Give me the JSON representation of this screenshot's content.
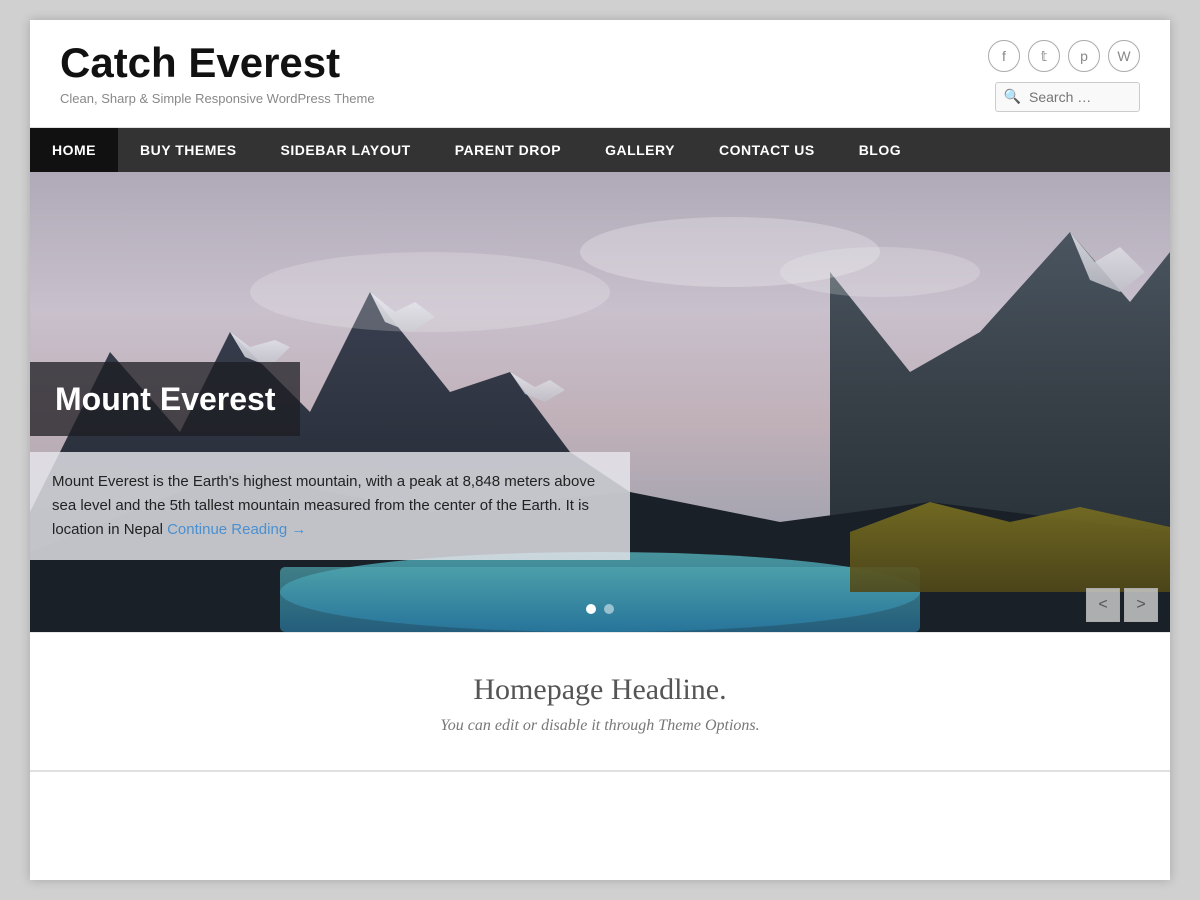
{
  "site": {
    "title": "Catch Everest",
    "description": "Clean, Sharp & Simple Responsive WordPress Theme"
  },
  "social": {
    "icons": [
      {
        "name": "facebook-icon",
        "symbol": "f"
      },
      {
        "name": "twitter-icon",
        "symbol": "t"
      },
      {
        "name": "pinterest-icon",
        "symbol": "p"
      },
      {
        "name": "wordpress-icon",
        "symbol": "W"
      }
    ]
  },
  "search": {
    "placeholder": "Search …"
  },
  "nav": {
    "items": [
      {
        "label": "HOME",
        "active": true
      },
      {
        "label": "BUY THEMES",
        "active": false
      },
      {
        "label": "SIDEBAR LAYOUT",
        "active": false
      },
      {
        "label": "PARENT DROP",
        "active": false
      },
      {
        "label": "GALLERY",
        "active": false
      },
      {
        "label": "CONTACT US",
        "active": false
      },
      {
        "label": "BLOG",
        "active": false
      }
    ]
  },
  "slider": {
    "slide_title": "Mount Everest",
    "slide_body": "Mount Everest is the Earth's highest mountain, with a peak at 8,848 meters above sea level and the 5th tallest mountain measured from the center of the Earth. It is location in Nepal",
    "continue_reading": "Continue Reading →",
    "prev_label": "<",
    "next_label": ">",
    "dots": [
      {
        "active": true
      },
      {
        "active": false
      }
    ]
  },
  "homepage": {
    "headline": "Homepage Headline.",
    "subheadline": "You can edit or disable it through Theme Options."
  }
}
